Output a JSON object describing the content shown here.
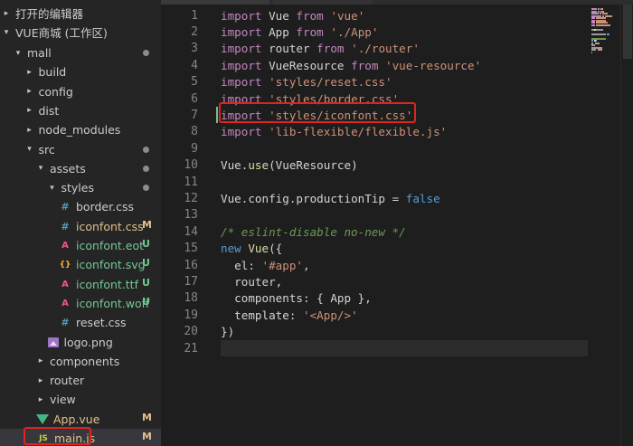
{
  "explorer": {
    "open_editors_label": "打开的编辑器",
    "workspace_label": "VUE商城 (工作区)",
    "tree": [
      {
        "label": "mall",
        "kind": "folder",
        "expanded": true,
        "depth": 0,
        "git": "dot"
      },
      {
        "label": "build",
        "kind": "folder",
        "expanded": false,
        "depth": 1,
        "git": ""
      },
      {
        "label": "config",
        "kind": "folder",
        "expanded": false,
        "depth": 1,
        "git": ""
      },
      {
        "label": "dist",
        "kind": "folder",
        "expanded": false,
        "depth": 1,
        "git": ""
      },
      {
        "label": "node_modules",
        "kind": "folder",
        "expanded": false,
        "depth": 1,
        "git": ""
      },
      {
        "label": "src",
        "kind": "folder",
        "expanded": true,
        "depth": 1,
        "git": "dot"
      },
      {
        "label": "assets",
        "kind": "folder",
        "expanded": true,
        "depth": 2,
        "git": "dot"
      },
      {
        "label": "styles",
        "kind": "folder",
        "expanded": true,
        "depth": 3,
        "git": "dot"
      },
      {
        "label": "border.css",
        "kind": "css",
        "depth": 4,
        "git": ""
      },
      {
        "label": "iconfont.css",
        "kind": "css",
        "depth": 4,
        "git": "M"
      },
      {
        "label": "iconfont.eot",
        "kind": "font",
        "depth": 4,
        "git": "U"
      },
      {
        "label": "iconfont.svg",
        "kind": "svg",
        "depth": 4,
        "git": "U"
      },
      {
        "label": "iconfont.ttf",
        "kind": "font",
        "depth": 4,
        "git": "U"
      },
      {
        "label": "iconfont.woff",
        "kind": "font",
        "depth": 4,
        "git": "U"
      },
      {
        "label": "reset.css",
        "kind": "css",
        "depth": 4,
        "git": ""
      },
      {
        "label": "logo.png",
        "kind": "image",
        "depth": 3,
        "git": ""
      },
      {
        "label": "components",
        "kind": "folder",
        "expanded": false,
        "depth": 2,
        "git": ""
      },
      {
        "label": "router",
        "kind": "folder",
        "expanded": false,
        "depth": 2,
        "git": ""
      },
      {
        "label": "view",
        "kind": "folder",
        "expanded": false,
        "depth": 2,
        "git": ""
      },
      {
        "label": "App.vue",
        "kind": "vue",
        "depth": 2,
        "git": "M"
      },
      {
        "label": "main.js",
        "kind": "js",
        "depth": 2,
        "git": "M"
      }
    ],
    "js_icon_text": "JS",
    "svg_icon_text": "{}",
    "css_icon_text": "#",
    "font_icon_text": "A"
  },
  "editor": {
    "current_line": 21,
    "modified_line": 7,
    "lines": [
      [
        {
          "t": "import",
          "c": "kw"
        },
        {
          "t": " Vue ",
          "c": "op"
        },
        {
          "t": "from",
          "c": "kw"
        },
        {
          "t": " ",
          "c": "op"
        },
        {
          "t": "'vue'",
          "c": "str"
        }
      ],
      [
        {
          "t": "import",
          "c": "kw"
        },
        {
          "t": " App ",
          "c": "op"
        },
        {
          "t": "from",
          "c": "kw"
        },
        {
          "t": " ",
          "c": "op"
        },
        {
          "t": "'./App'",
          "c": "str"
        }
      ],
      [
        {
          "t": "import",
          "c": "kw"
        },
        {
          "t": " router ",
          "c": "op"
        },
        {
          "t": "from",
          "c": "kw"
        },
        {
          "t": " ",
          "c": "op"
        },
        {
          "t": "'./router'",
          "c": "str"
        }
      ],
      [
        {
          "t": "import",
          "c": "kw"
        },
        {
          "t": " VueResource ",
          "c": "op"
        },
        {
          "t": "from",
          "c": "kw"
        },
        {
          "t": " ",
          "c": "op"
        },
        {
          "t": "'vue-resource'",
          "c": "str"
        }
      ],
      [
        {
          "t": "import",
          "c": "kw"
        },
        {
          "t": " ",
          "c": "op"
        },
        {
          "t": "'styles/reset.css'",
          "c": "str"
        }
      ],
      [
        {
          "t": "import",
          "c": "kw"
        },
        {
          "t": " ",
          "c": "op"
        },
        {
          "t": "'styles/border.css'",
          "c": "str"
        }
      ],
      [
        {
          "t": "import",
          "c": "kw"
        },
        {
          "t": " ",
          "c": "op"
        },
        {
          "t": "'styles/iconfont.css'",
          "c": "str"
        }
      ],
      [
        {
          "t": "import",
          "c": "kw"
        },
        {
          "t": " ",
          "c": "op"
        },
        {
          "t": "'lib-flexible/flexible.js'",
          "c": "str"
        }
      ],
      [],
      [
        {
          "t": "Vue",
          "c": "op"
        },
        {
          "t": ".",
          "c": "op"
        },
        {
          "t": "use",
          "c": "fn"
        },
        {
          "t": "(VueResource)",
          "c": "op"
        }
      ],
      [],
      [
        {
          "t": "Vue",
          "c": "op"
        },
        {
          "t": ".config.productionTip ",
          "c": "op"
        },
        {
          "t": "=",
          "c": "op"
        },
        {
          "t": " ",
          "c": "op"
        },
        {
          "t": "false",
          "c": "bool"
        }
      ],
      [],
      [
        {
          "t": "/* eslint-disable no-new */",
          "c": "com"
        }
      ],
      [
        {
          "t": "new",
          "c": "bool"
        },
        {
          "t": " ",
          "c": "op"
        },
        {
          "t": "Vue",
          "c": "fn"
        },
        {
          "t": "({",
          "c": "op"
        }
      ],
      [
        {
          "t": "  el: ",
          "c": "op"
        },
        {
          "t": "'#app'",
          "c": "str"
        },
        {
          "t": ",",
          "c": "op"
        }
      ],
      [
        {
          "t": "  router,",
          "c": "op"
        }
      ],
      [
        {
          "t": "  components: { App },",
          "c": "op"
        }
      ],
      [
        {
          "t": "  template: ",
          "c": "op"
        },
        {
          "t": "'<App/>'",
          "c": "str"
        }
      ],
      [
        {
          "t": "})",
          "c": "op"
        }
      ],
      []
    ]
  },
  "colors": {
    "sidebar_bg": "#252526",
    "editor_bg": "#1e1e1e",
    "highlight_red": "#e0231f",
    "keyword": "#c586c0",
    "string": "#ce9178",
    "function": "#dcdcaa",
    "comment": "#6a9955"
  }
}
